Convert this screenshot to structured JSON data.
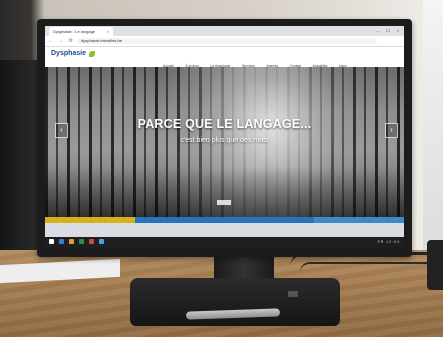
{
  "browser": {
    "tab_title": "Dysphasie - Le langage",
    "tab_close": "×",
    "window_controls": "– ☐ ×",
    "nav": "← → ⟳",
    "url": "dysphasie-bruxelles.be"
  },
  "site": {
    "logo": "Dysphasie",
    "logo_sub": "",
    "menu": [
      "Accueil",
      "À propos",
      "La dysphasie",
      "Services",
      "Agenda",
      "Contact",
      "Actualités",
      "Liens"
    ],
    "hero": {
      "title": "PARCE QUE LE LANGAGE...",
      "subtitle": "c'est bien plus que des mots",
      "prev": "‹",
      "next": "›"
    },
    "strip_colors": [
      "#d4b21c",
      "#2a73b8",
      "#2a73b8",
      "#3b8bc9"
    ]
  },
  "taskbar": {
    "tray": "FR  12:04",
    "icon_colors": [
      "#ffffff",
      "#3a7bd5",
      "#e0a030",
      "#2f8f4f",
      "#d04a3a",
      "#4aa3df"
    ]
  }
}
